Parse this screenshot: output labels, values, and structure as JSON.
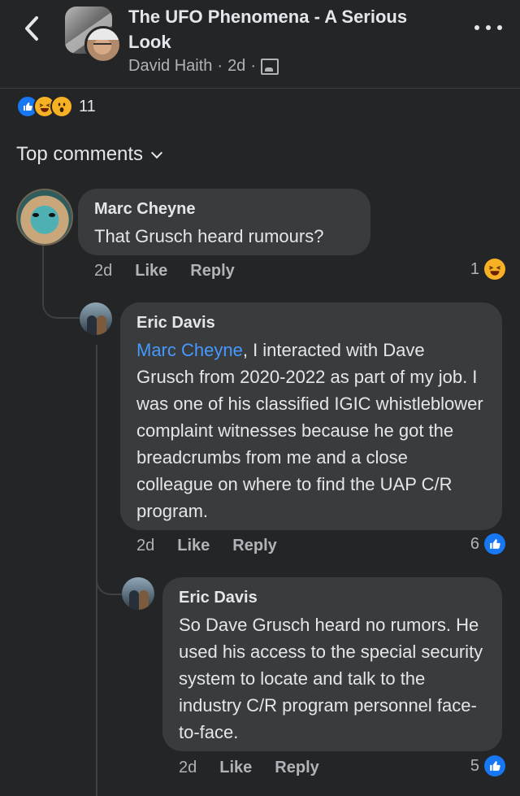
{
  "header": {
    "title": "The UFO Phenomena - A Serious Look",
    "author": "David Haith",
    "sep1": "·",
    "time": "2d",
    "sep2": "·"
  },
  "post_reactions": {
    "count": "11",
    "types": [
      "like",
      "haha",
      "wow"
    ]
  },
  "comments_section": {
    "label": "Top comments"
  },
  "comments": [
    {
      "author": "Marc Cheyne",
      "text": "That Grusch heard rumours?",
      "time": "2d",
      "like_label": "Like",
      "reply_label": "Reply",
      "reaction_count": "1",
      "reaction": "haha"
    },
    {
      "author": "Eric Davis",
      "mention": "Marc Cheyne",
      "text": ", I interacted with Dave Grusch from 2020-2022 as part of my job. I was one of his classified IGIC whistleblower complaint witnesses because he got the breadcrumbs from me and a close colleague on where to find the UAP C/R program.",
      "time": "2d",
      "like_label": "Like",
      "reply_label": "Reply",
      "reaction_count": "6",
      "reaction": "like"
    },
    {
      "author": "Eric Davis",
      "text": "So Dave Grusch heard no rumors. He used his access to the special security system to locate and talk to the industry C/R program personnel face-to-face.",
      "time": "2d",
      "like_label": "Like",
      "reply_label": "Reply",
      "reaction_count": "5",
      "reaction": "like"
    }
  ],
  "colors": {
    "background": "#242526",
    "bubble": "#3a3b3c",
    "text_primary": "#e4e6eb",
    "text_secondary": "#b0b3b8",
    "mention": "#4599ff",
    "like_blue": "#1877f2",
    "haha_yellow": "#f7b125"
  },
  "icons": {
    "back": "chevron-left-icon",
    "more": "more-horizontal-icon",
    "privacy": "group-privacy-icon",
    "dropdown": "chevron-down-icon",
    "like": "thumbs-up-icon",
    "haha": "laughing-face-icon",
    "wow": "surprised-face-icon"
  }
}
